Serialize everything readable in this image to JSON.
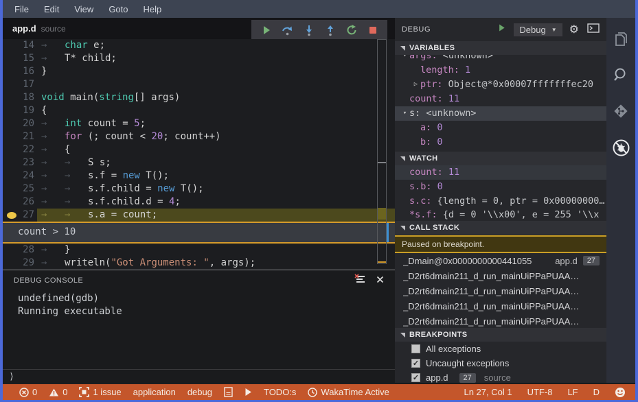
{
  "menu": [
    "File",
    "Edit",
    "View",
    "Goto",
    "Help"
  ],
  "tab": {
    "name": "app.d",
    "hint": "source"
  },
  "toolbar": {
    "buttons": [
      "continue",
      "step-over",
      "step-into",
      "step-out",
      "restart",
      "stop"
    ]
  },
  "editor": {
    "widget_condition": "count > 10",
    "lines": [
      {
        "num": "14",
        "tokens": [
          {
            "c": "ws"
          },
          {
            "c": "kw",
            "t": "char"
          },
          {
            "c": "pl",
            "t": " e;"
          }
        ]
      },
      {
        "num": "15",
        "tokens": [
          {
            "c": "ws"
          },
          {
            "c": "pl",
            "t": "T* child;"
          }
        ]
      },
      {
        "num": "16",
        "tokens": [
          {
            "c": "pl",
            "t": "}"
          }
        ]
      },
      {
        "num": "17",
        "tokens": []
      },
      {
        "num": "18",
        "tokens": [
          {
            "c": "kw",
            "t": "void"
          },
          {
            "c": "pl",
            "t": " main("
          },
          {
            "c": "kw",
            "t": "string"
          },
          {
            "c": "pl",
            "t": "[] args)"
          }
        ]
      },
      {
        "num": "19",
        "tokens": [
          {
            "c": "pl",
            "t": "{"
          }
        ]
      },
      {
        "num": "20",
        "tokens": [
          {
            "c": "ws"
          },
          {
            "c": "kw",
            "t": "int"
          },
          {
            "c": "pl",
            "t": " count = "
          },
          {
            "c": "num",
            "t": "5"
          },
          {
            "c": "pl",
            "t": ";"
          }
        ]
      },
      {
        "num": "21",
        "tokens": [
          {
            "c": "ws"
          },
          {
            "c": "ctrl",
            "t": "for"
          },
          {
            "c": "pl",
            "t": " (; count < "
          },
          {
            "c": "num",
            "t": "20"
          },
          {
            "c": "pl",
            "t": "; count++)"
          }
        ]
      },
      {
        "num": "22",
        "tokens": [
          {
            "c": "ws"
          },
          {
            "c": "pl",
            "t": "{"
          }
        ]
      },
      {
        "num": "23",
        "tokens": [
          {
            "c": "ws"
          },
          {
            "c": "ws"
          },
          {
            "c": "pl",
            "t": "S s;"
          }
        ]
      },
      {
        "num": "24",
        "tokens": [
          {
            "c": "ws"
          },
          {
            "c": "ws"
          },
          {
            "c": "pl",
            "t": "s.f = "
          },
          {
            "c": "new",
            "t": "new"
          },
          {
            "c": "pl",
            "t": " T();"
          }
        ]
      },
      {
        "num": "25",
        "tokens": [
          {
            "c": "ws"
          },
          {
            "c": "ws"
          },
          {
            "c": "pl",
            "t": "s.f.child = "
          },
          {
            "c": "new",
            "t": "new"
          },
          {
            "c": "pl",
            "t": " T();"
          }
        ]
      },
      {
        "num": "26",
        "tokens": [
          {
            "c": "ws"
          },
          {
            "c": "ws"
          },
          {
            "c": "pl",
            "t": "s.f.child.d = "
          },
          {
            "c": "num",
            "t": "4"
          },
          {
            "c": "pl",
            "t": ";"
          }
        ]
      },
      {
        "num": "27",
        "bp": true,
        "current": true,
        "tokens": [
          {
            "c": "ws"
          },
          {
            "c": "ws"
          },
          {
            "c": "pl",
            "t": "s.a = count;"
          }
        ]
      },
      {
        "widget": true
      },
      {
        "num": "28",
        "tokens": [
          {
            "c": "ws"
          },
          {
            "c": "pl",
            "t": "}"
          }
        ]
      },
      {
        "num": "29",
        "tokens": [
          {
            "c": "ws"
          },
          {
            "c": "pl",
            "t": "writeln("
          },
          {
            "c": "str",
            "t": "\"Got Arguments: \""
          },
          {
            "c": "pl",
            "t": ", args);"
          }
        ]
      }
    ]
  },
  "debug_panel": {
    "title": "DEBUG",
    "config_name": "Debug",
    "sections": {
      "variables": "VARIABLES",
      "watch": "WATCH",
      "callstack": "CALL STACK",
      "breakpoints": "BREAKPOINTS"
    },
    "variables_rows": [
      {
        "exp": "▾",
        "name": "args",
        "value": " <unknown>",
        "ind": 0,
        "clipped": true
      },
      {
        "name": "length",
        "value": " 1",
        "vtype": "num",
        "ind": 1
      },
      {
        "exp": "▷",
        "name": "ptr",
        "value": " Object@*0x00007fffffffec20",
        "ind": 1
      },
      {
        "name": "count",
        "value": " 11",
        "vtype": "num",
        "ind": 0
      },
      {
        "exp": "▾",
        "name": "s",
        "value": " <unknown>",
        "ind": 0,
        "selected": true,
        "plainName": true
      },
      {
        "name": "a",
        "value": " 0",
        "vtype": "num",
        "ind": 1
      },
      {
        "name": "b",
        "value": " 0",
        "vtype": "num",
        "ind": 1
      }
    ],
    "watch_rows": [
      {
        "name": "count",
        "value": " 11",
        "vtype": "num",
        "highlight": true
      },
      {
        "name": "s.b",
        "value": " 0",
        "vtype": "num"
      },
      {
        "name": "s.c",
        "value": " {length = 0, ptr = 0x00000000…"
      },
      {
        "name": "*s.f",
        "value": " {d = 0 '\\\\x00', e = 255 '\\\\x",
        "clipped": true
      }
    ],
    "callstack": {
      "banner": "Paused on breakpoint.",
      "frames": [
        {
          "label": "_Dmain@0x0000000000441055",
          "file": "app.d",
          "line": "27"
        },
        {
          "label": "_D2rt6dmain211_d_run_mainUiPPaPUAA…"
        },
        {
          "label": "_D2rt6dmain211_d_run_mainUiPPaPUAA…"
        },
        {
          "label": "_D2rt6dmain211_d_run_mainUiPPaPUAA…"
        },
        {
          "label": "_D2rt6dmain211_d_run_mainUiPPaPUAA…"
        }
      ]
    },
    "breakpoints_rows": [
      {
        "checked": false,
        "label": "All exceptions"
      },
      {
        "checked": true,
        "label": "Uncaught exceptions"
      },
      {
        "checked": true,
        "label": "app.d",
        "badge": "27",
        "suffix": "source"
      }
    ]
  },
  "console": {
    "title": "DEBUG CONSOLE",
    "lines": [
      "undefined(gdb)",
      "Running executable"
    ],
    "prompt": "⟩"
  },
  "statusbar": {
    "left": [
      {
        "icon": "error",
        "text": "0"
      },
      {
        "icon": "warning",
        "text": "0"
      },
      {
        "icon": "issues",
        "text": "1 issue"
      },
      {
        "text": "application"
      },
      {
        "text": "debug"
      },
      {
        "icon": "doc",
        "text": ""
      },
      {
        "icon": "play",
        "text": ""
      },
      {
        "text": "TODO:s"
      },
      {
        "icon": "clock",
        "text": "WakaTime Active"
      }
    ],
    "right": [
      "Ln 27, Col 1",
      "UTF-8",
      "LF",
      "D"
    ]
  },
  "colors": {
    "accent_border": "#4c69d8",
    "status_bar": "#c4562b",
    "breakpoint": "#edc648",
    "current_line": "#4c491d",
    "banner_border": "#c99e26"
  }
}
